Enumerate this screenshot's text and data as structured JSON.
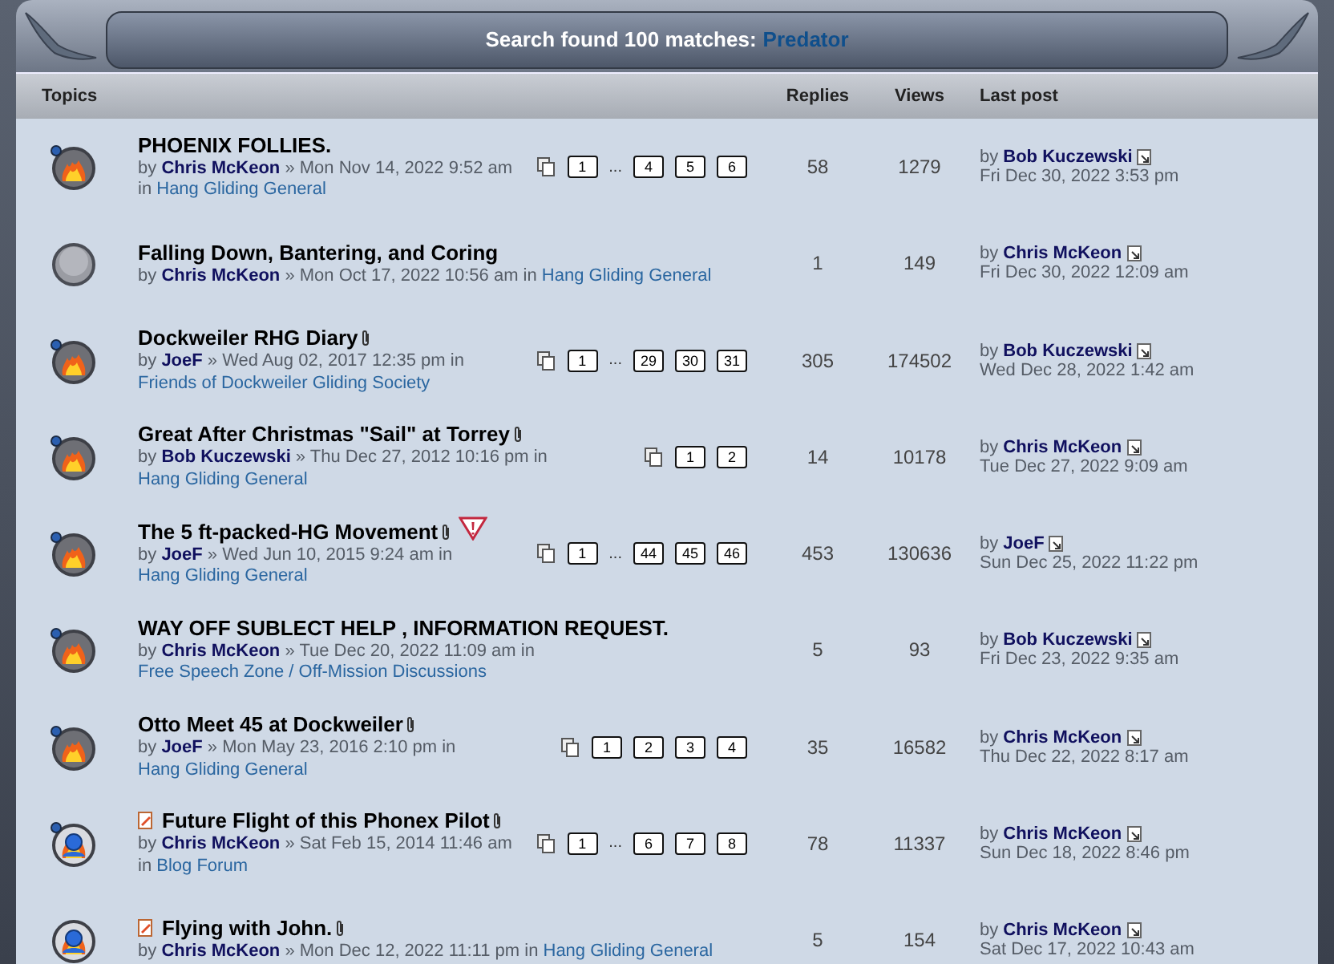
{
  "header": {
    "title": "Search found 100 matches:",
    "query": "Predator"
  },
  "columns": {
    "topics": "Topics",
    "replies": "Replies",
    "views": "Views",
    "last_post": "Last post"
  },
  "topics": [
    {
      "kind": "hot",
      "unread": true,
      "note": false,
      "title": "PHOENIX FOLLIES.",
      "attachment": false,
      "reported": false,
      "by": "by",
      "author": "Chris McKeon",
      "meta": "» Mon Nov 14, 2022 9:52 am in",
      "forum": "Hang Gliding General",
      "pages": [
        {
          "kind": "page",
          "label": "1"
        },
        {
          "kind": "ellipsis",
          "label": "..."
        },
        {
          "kind": "page",
          "label": "4"
        },
        {
          "kind": "page",
          "label": "5"
        },
        {
          "kind": "page",
          "label": "6"
        }
      ],
      "replies": "58",
      "views": "1279",
      "last_by": "by",
      "last_author": "Bob Kuczewski",
      "last_date": "Fri Dec 30, 2022 3:53 pm"
    },
    {
      "kind": "read",
      "unread": false,
      "note": false,
      "title": "Falling Down, Bantering, and Coring",
      "attachment": false,
      "reported": false,
      "by": "by",
      "author": "Chris McKeon",
      "meta": "» Mon Oct 17, 2022 10:56 am in",
      "forum": "Hang Gliding General",
      "replies": "1",
      "views": "149",
      "last_by": "by",
      "last_author": "Chris McKeon",
      "last_date": "Fri Dec 30, 2022 12:09 am"
    },
    {
      "kind": "hot",
      "unread": true,
      "note": false,
      "title": "Dockweiler RHG Diary",
      "attachment": true,
      "reported": false,
      "by": "by",
      "author": "JoeF",
      "meta": "» Wed Aug 02, 2017 12:35 pm in",
      "forum": "Friends of Dockweiler Gliding Society",
      "pages": [
        {
          "kind": "page",
          "label": "1"
        },
        {
          "kind": "ellipsis",
          "label": "..."
        },
        {
          "kind": "page",
          "label": "29"
        },
        {
          "kind": "page",
          "label": "30"
        },
        {
          "kind": "page",
          "label": "31"
        }
      ],
      "replies": "305",
      "views": "174502",
      "last_by": "by",
      "last_author": "Bob Kuczewski",
      "last_date": "Wed Dec 28, 2022 1:42 am"
    },
    {
      "kind": "hot",
      "unread": true,
      "note": false,
      "title": "Great After Christmas \"Sail\" at Torrey",
      "attachment": true,
      "reported": false,
      "by": "by",
      "author": "Bob Kuczewski",
      "meta": "» Thu Dec 27, 2012 10:16 pm in",
      "forum": "Hang Gliding General",
      "pages": [
        {
          "kind": "page",
          "label": "1"
        },
        {
          "kind": "page",
          "label": "2"
        }
      ],
      "replies": "14",
      "views": "10178",
      "last_by": "by",
      "last_author": "Chris McKeon",
      "last_date": "Tue Dec 27, 2022 9:09 am"
    },
    {
      "kind": "hot",
      "unread": true,
      "note": false,
      "title": "The 5 ft-packed-HG Movement",
      "attachment": true,
      "reported": true,
      "by": "by",
      "author": "JoeF",
      "meta": "» Wed Jun 10, 2015 9:24 am in",
      "forum": "Hang Gliding General",
      "pages": [
        {
          "kind": "page",
          "label": "1"
        },
        {
          "kind": "ellipsis",
          "label": "..."
        },
        {
          "kind": "page",
          "label": "44"
        },
        {
          "kind": "page",
          "label": "45"
        },
        {
          "kind": "page",
          "label": "46"
        }
      ],
      "replies": "453",
      "views": "130636",
      "last_by": "by",
      "last_author": "JoeF",
      "last_date": "Sun Dec 25, 2022 11:22 pm"
    },
    {
      "kind": "hot",
      "unread": true,
      "note": false,
      "title": "WAY OFF SUBLECT HELP , INFORMATION REQUEST.",
      "attachment": false,
      "reported": false,
      "by": "by",
      "author": "Chris McKeon",
      "meta": "» Tue Dec 20, 2022 11:09 am in",
      "forum": "Free Speech Zone / Off-Mission Discussions",
      "replies": "5",
      "views": "93",
      "last_by": "by",
      "last_author": "Bob Kuczewski",
      "last_date": "Fri Dec 23, 2022 9:35 am"
    },
    {
      "kind": "hot",
      "unread": true,
      "note": false,
      "title": "Otto Meet 45 at Dockweiler",
      "attachment": true,
      "reported": false,
      "by": "by",
      "author": "JoeF",
      "meta": "» Mon May 23, 2016 2:10 pm in",
      "forum": "Hang Gliding General",
      "pages": [
        {
          "kind": "page",
          "label": "1"
        },
        {
          "kind": "page",
          "label": "2"
        },
        {
          "kind": "page",
          "label": "3"
        },
        {
          "kind": "page",
          "label": "4"
        }
      ],
      "replies": "35",
      "views": "16582",
      "last_by": "by",
      "last_author": "Chris McKeon",
      "last_date": "Thu Dec 22, 2022 8:17 am"
    },
    {
      "kind": "hot_posted",
      "unread": true,
      "note": true,
      "title": "Future Flight of this Phonex Pilot",
      "attachment": true,
      "reported": false,
      "by": "by",
      "author": "Chris McKeon",
      "meta": "» Sat Feb 15, 2014 11:46 am in",
      "forum": "Blog Forum",
      "pages": [
        {
          "kind": "page",
          "label": "1"
        },
        {
          "kind": "ellipsis",
          "label": "..."
        },
        {
          "kind": "page",
          "label": "6"
        },
        {
          "kind": "page",
          "label": "7"
        },
        {
          "kind": "page",
          "label": "8"
        }
      ],
      "replies": "78",
      "views": "11337",
      "last_by": "by",
      "last_author": "Chris McKeon",
      "last_date": "Sun Dec 18, 2022 8:46 pm"
    },
    {
      "kind": "hot_posted",
      "unread": false,
      "note": true,
      "title": "Flying with John.",
      "attachment": true,
      "reported": false,
      "by": "by",
      "author": "Chris McKeon",
      "meta": "» Mon Dec 12, 2022 11:11 pm in",
      "forum": "Hang Gliding General",
      "replies": "5",
      "views": "154",
      "last_by": "by",
      "last_author": "Chris McKeon",
      "last_date": "Sat Dec 17, 2022 10:43 am"
    }
  ]
}
